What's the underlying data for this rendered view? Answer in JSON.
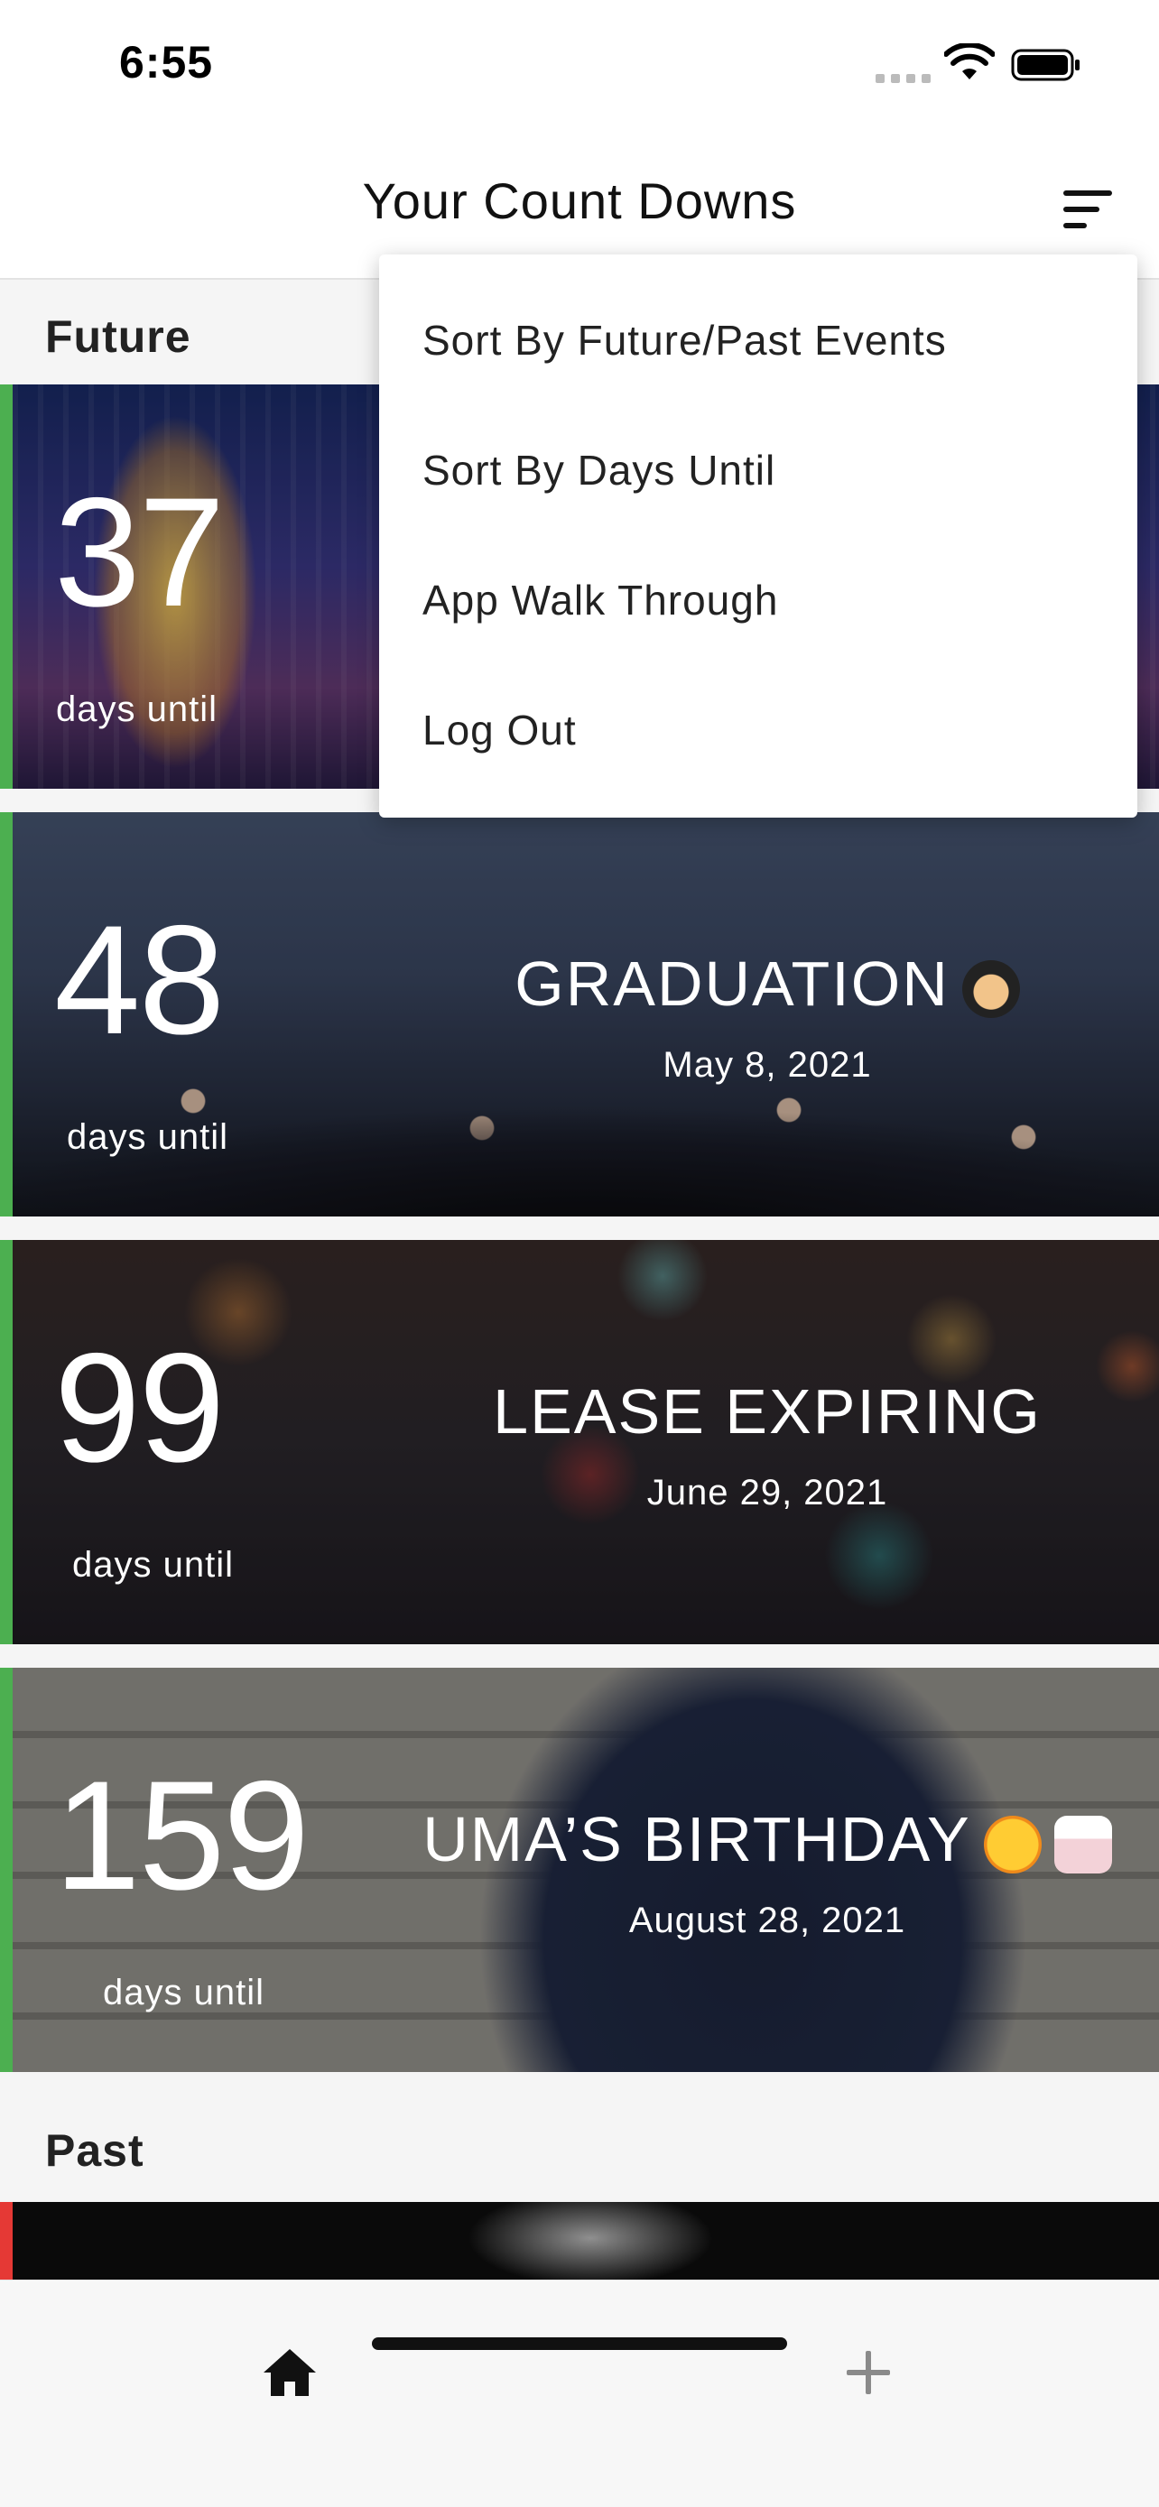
{
  "status_bar": {
    "time": "6:55"
  },
  "nav": {
    "title": "Your Count Downs"
  },
  "sections": {
    "future": "Future",
    "past": "Past"
  },
  "cards": [
    {
      "days": "37",
      "label": "days until",
      "title": "",
      "date": "",
      "stripe_color": "#4caf50"
    },
    {
      "days": "48",
      "label": "days until",
      "title": "GRADUATION",
      "emoji": "graduate-emoji",
      "date": "May 8, 2021",
      "stripe_color": "#4caf50"
    },
    {
      "days": "99",
      "label": "days until",
      "title": "LEASE EXPIRING",
      "date": "June 29, 2021",
      "stripe_color": "#4caf50"
    },
    {
      "days": "159",
      "label": "days until",
      "title": "UMA’S BIRTHDAY",
      "emoji": "party-face-emoji, birthday-cake-emoji",
      "date": "August 28, 2021",
      "stripe_color": "#4caf50"
    }
  ],
  "past_card": {
    "stripe_color": "#e53935"
  },
  "menu": {
    "items": [
      "Sort By Future/Past Events",
      "Sort By Days Until",
      "App Walk Through",
      "Log Out"
    ]
  },
  "tab_bar": {
    "home_icon": "home-icon",
    "add_icon": "plus-icon"
  }
}
